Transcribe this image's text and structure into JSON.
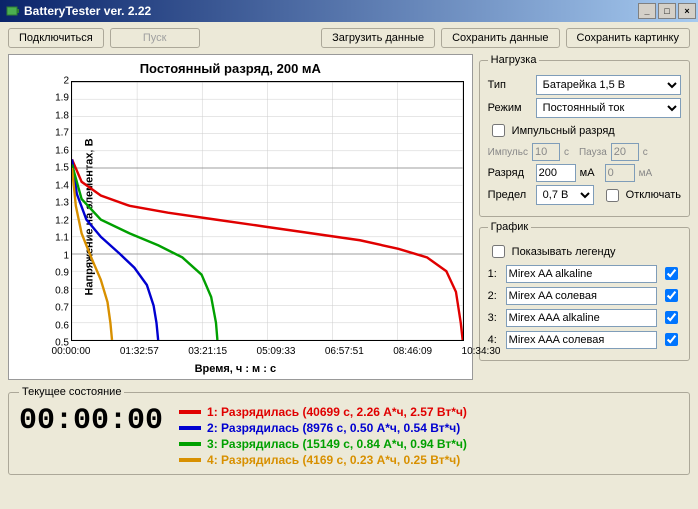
{
  "window": {
    "title": "BatteryTester ver. 2.22"
  },
  "toolbar": {
    "connect": "Подключиться",
    "start": "Пуск",
    "load": "Загрузить данные",
    "save": "Сохранить данные",
    "save_image": "Сохранить картинку"
  },
  "chart_data": {
    "type": "line",
    "title": "Постоянный разряд, 200 мА",
    "xlabel": "Время, ч : м : с",
    "ylabel": "Напряжение на элементах, В",
    "ylim": [
      0.5,
      2.0
    ],
    "yticks": [
      0.5,
      0.6,
      0.7,
      0.8,
      0.9,
      1,
      1.1,
      1.2,
      1.3,
      1.4,
      1.5,
      1.6,
      1.7,
      1.8,
      1.9,
      2
    ],
    "x_categories": [
      "00:00:00",
      "01:32:57",
      "03:21:15",
      "05:09:33",
      "06:57:51",
      "08:46:09",
      "10:34:30"
    ],
    "x_max_seconds": 40699,
    "series": [
      {
        "name": "Mirex AA alkaline",
        "color": "#e00000",
        "duration_s": 40699,
        "points": [
          [
            0,
            1.55
          ],
          [
            1000,
            1.42
          ],
          [
            3000,
            1.34
          ],
          [
            6000,
            1.28
          ],
          [
            10000,
            1.24
          ],
          [
            15000,
            1.2
          ],
          [
            20000,
            1.16
          ],
          [
            25000,
            1.12
          ],
          [
            30000,
            1.08
          ],
          [
            34000,
            1.03
          ],
          [
            37000,
            0.98
          ],
          [
            39000,
            0.9
          ],
          [
            40000,
            0.78
          ],
          [
            40500,
            0.6
          ],
          [
            40699,
            0.5
          ]
        ]
      },
      {
        "name": "Mirex AA солевая",
        "color": "#0000d0",
        "duration_s": 8976,
        "points": [
          [
            0,
            1.55
          ],
          [
            500,
            1.35
          ],
          [
            1500,
            1.2
          ],
          [
            3000,
            1.1
          ],
          [
            5000,
            1.0
          ],
          [
            6500,
            0.92
          ],
          [
            7800,
            0.82
          ],
          [
            8500,
            0.7
          ],
          [
            8800,
            0.6
          ],
          [
            8976,
            0.5
          ]
        ]
      },
      {
        "name": "Mirex AAA alkaline",
        "color": "#00a000",
        "duration_s": 15149,
        "points": [
          [
            0,
            1.52
          ],
          [
            1000,
            1.32
          ],
          [
            3000,
            1.2
          ],
          [
            6000,
            1.12
          ],
          [
            9000,
            1.05
          ],
          [
            11500,
            0.98
          ],
          [
            13500,
            0.88
          ],
          [
            14500,
            0.75
          ],
          [
            15000,
            0.6
          ],
          [
            15149,
            0.5
          ]
        ]
      },
      {
        "name": "Mirex AAA солевая",
        "color": "#d89000",
        "duration_s": 4169,
        "points": [
          [
            0,
            1.5
          ],
          [
            400,
            1.28
          ],
          [
            1000,
            1.12
          ],
          [
            2000,
            0.98
          ],
          [
            3000,
            0.85
          ],
          [
            3700,
            0.72
          ],
          [
            4000,
            0.6
          ],
          [
            4169,
            0.5
          ]
        ]
      }
    ]
  },
  "load_panel": {
    "legend": "Нагрузка",
    "type_label": "Тип",
    "type_value": "Батарейка 1,5 В",
    "mode_label": "Режим",
    "mode_value": "Постоянный ток",
    "pulse_checkbox": "Импульсный разряд",
    "pulse_label": "Импульс",
    "pulse_value": "10",
    "pulse_unit": "с",
    "pause_label": "Пауза",
    "pause_value": "20",
    "pause_unit": "с",
    "discharge_label": "Разряд",
    "discharge_value": "200",
    "discharge_unit": "мА",
    "discharge2_value": "0",
    "discharge2_unit": "мА",
    "limit_label": "Предел",
    "limit_value": "0,7 В",
    "disconnect_checkbox": "Отключать"
  },
  "graph_panel": {
    "legend": "График",
    "show_legend": "Показывать легенду",
    "rows": [
      {
        "idx": "1:",
        "name": "Mirex AA alkaline"
      },
      {
        "idx": "2:",
        "name": "Mirex AA солевая"
      },
      {
        "idx": "3:",
        "name": "Mirex AAA alkaline"
      },
      {
        "idx": "4:",
        "name": "Mirex AAA солевая"
      }
    ]
  },
  "status": {
    "legend": "Текущее состояние",
    "clock": "00:00:00",
    "lines": [
      "1: Разрядилась (40699 с, 2.26 А*ч, 2.57 Вт*ч)",
      "2: Разрядилась (8976 с, 0.50 А*ч, 0.54 Вт*ч)",
      "3: Разрядилась (15149 с, 0.84 А*ч, 0.94 Вт*ч)",
      "4: Разрядилась (4169 с, 0.23 А*ч, 0.25 Вт*ч)"
    ]
  }
}
